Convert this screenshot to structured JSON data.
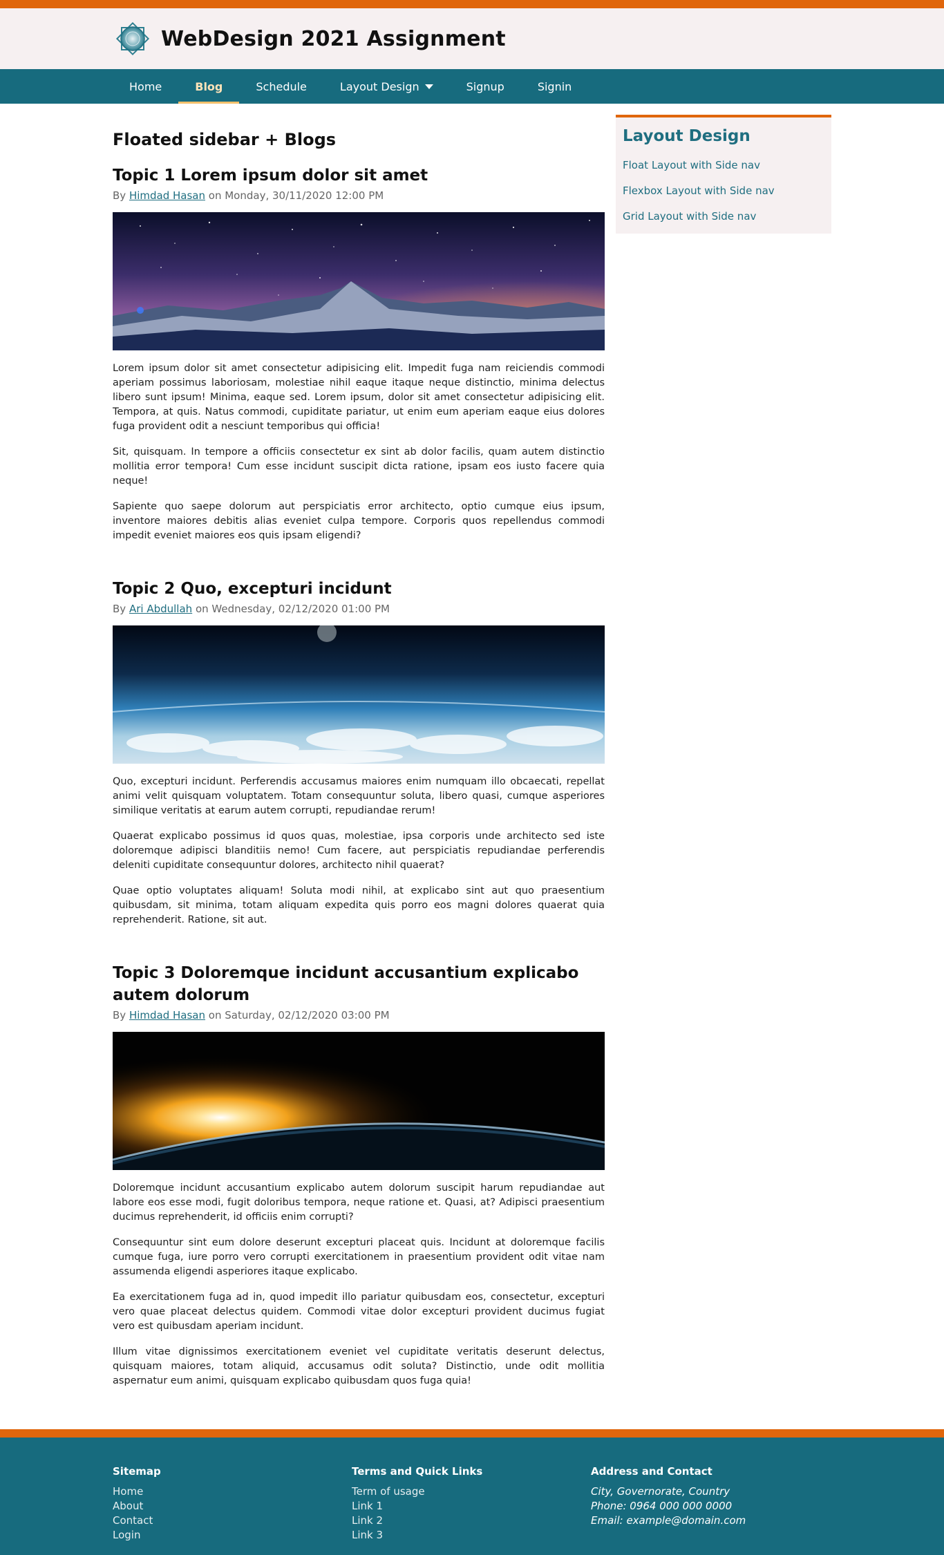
{
  "site": {
    "title": "WebDesign 2021 Assignment",
    "logo_icon": "star-emblem-icon",
    "colors": {
      "accent": "#e0660c",
      "primary": "#176b7e",
      "header_bg": "#f6f0f1"
    }
  },
  "nav": {
    "items": [
      {
        "label": "Home"
      },
      {
        "label": "Blog",
        "active": true
      },
      {
        "label": "Schedule"
      },
      {
        "label": "Layout Design",
        "dropdown": true
      },
      {
        "label": "Signup"
      },
      {
        "label": "Signin"
      }
    ]
  },
  "main": {
    "section_title": "Floated sidebar + Blogs",
    "posts": [
      {
        "title": "Topic 1 Lorem ipsum dolor sit amet",
        "by": "By",
        "author": "Himdad Hasan",
        "on": "on Monday, 30/11/2020 12:00 PM",
        "image": "starry-mountain-image",
        "paragraphs": [
          "Lorem ipsum dolor sit amet consectetur adipisicing elit. Impedit fuga nam reiciendis commodi aperiam possimus laboriosam, molestiae nihil eaque itaque neque distinctio, minima delectus libero sunt ipsum! Minima, eaque sed. Lorem ipsum, dolor sit amet consectetur adipisicing elit. Tempora, at quis. Natus commodi, cupiditate pariatur, ut enim eum aperiam eaque eius dolores fuga provident odit a nesciunt temporibus qui officia!",
          "Sit, quisquam. In tempore a officiis consectetur ex sint ab dolor facilis, quam autem distinctio mollitia error tempora! Cum esse incidunt suscipit dicta ratione, ipsam eos iusto facere quia neque!",
          "Sapiente quo saepe dolorum aut perspiciatis error architecto, optio cumque eius ipsum, inventore maiores debitis alias eveniet culpa tempore. Corporis quos repellendus commodi impedit eveniet maiores eos quis ipsam eligendi?"
        ]
      },
      {
        "title": "Topic 2 Quo, excepturi incidunt",
        "by": "By",
        "author": "Ari Abdullah",
        "on": "on Wednesday, 02/12/2020 01:00 PM",
        "image": "earth-atmosphere-image",
        "paragraphs": [
          "Quo, excepturi incidunt. Perferendis accusamus maiores enim numquam illo obcaecati, repellat animi velit quisquam voluptatem. Totam consequuntur soluta, libero quasi, cumque asperiores similique veritatis at earum autem corrupti, repudiandae rerum!",
          "Quaerat explicabo possimus id quos quas, molestiae, ipsa corporis unde architecto sed iste doloremque adipisci blanditiis nemo! Cum facere, aut perspiciatis repudiandae perferendis deleniti cupiditate consequuntur dolores, architecto nihil quaerat?",
          "Quae optio voluptates aliquam! Soluta modi nihil, at explicabo sint aut quo praesentium quibusdam, sit minima, totam aliquam expedita quis porro eos magni dolores quaerat quia reprehenderit. Ratione, sit aut."
        ]
      },
      {
        "title": "Topic 3 Doloremque incidunt accusantium explicabo autem dolorum",
        "by": "By",
        "author": "Himdad Hasan",
        "on": "on Saturday, 02/12/2020 03:00 PM",
        "image": "planet-sunrise-image",
        "paragraphs": [
          "Doloremque incidunt accusantium explicabo autem dolorum suscipit harum repudiandae aut labore eos esse modi, fugit doloribus tempora, neque ratione et. Quasi, at? Adipisci praesentium ducimus reprehenderit, id officiis enim corrupti?",
          "Consequuntur sint eum dolore deserunt excepturi placeat quis. Incidunt at doloremque facilis cumque fuga, iure porro vero corrupti exercitationem in praesentium provident odit vitae nam assumenda eligendi asperiores itaque explicabo.",
          "Ea exercitationem fuga ad in, quod impedit illo pariatur quibusdam eos, consectetur, excepturi vero quae placeat delectus quidem. Commodi vitae dolor excepturi provident ducimus fugiat vero est quibusdam aperiam incidunt.",
          "Illum vitae dignissimos exercitationem eveniet vel cupiditate veritatis deserunt delectus, quisquam maiores, totam aliquid, accusamus odit soluta? Distinctio, unde odit mollitia aspernatur eum animi, quisquam explicabo quibusdam quos fuga quia!"
        ]
      }
    ]
  },
  "sidebar": {
    "title": "Layout Design",
    "links": [
      {
        "label": "Float Layout with Side nav"
      },
      {
        "label": "Flexbox Layout with Side nav"
      },
      {
        "label": "Grid Layout with Side nav"
      }
    ]
  },
  "footer": {
    "sitemap": {
      "heading": "Sitemap",
      "links": [
        "Home",
        "About",
        "Contact",
        "Login"
      ]
    },
    "terms": {
      "heading": "Terms and Quick Links",
      "links": [
        "Term of usage",
        "Link 1",
        "Link 2",
        "Link 3"
      ]
    },
    "address": {
      "heading": "Address and Contact",
      "lines": [
        "City, Governorate, Country",
        "Phone: 0964 000 000 0000",
        "Email: example@domain.com"
      ]
    }
  }
}
